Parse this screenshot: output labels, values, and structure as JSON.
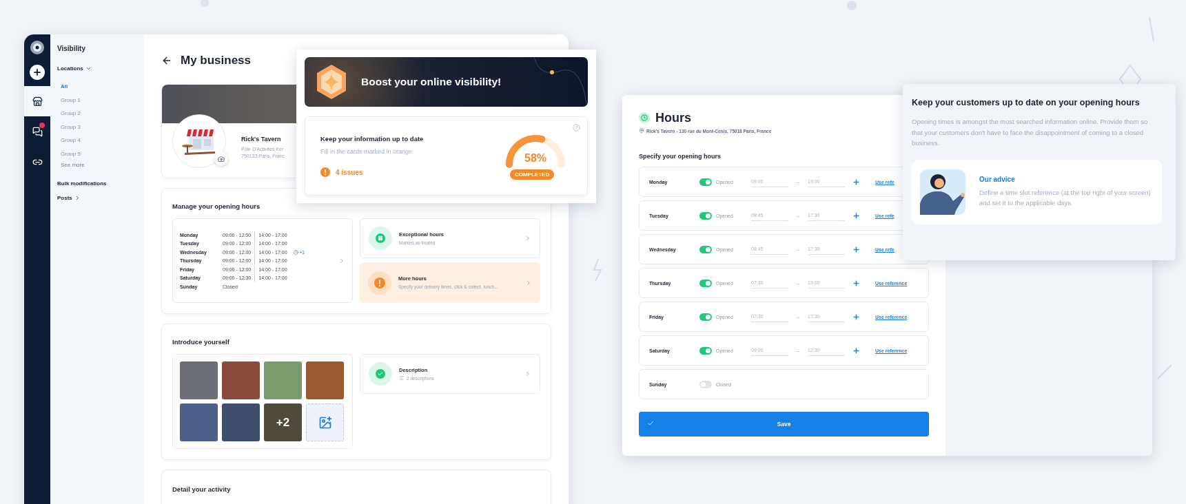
{
  "rail": {
    "items": [
      {
        "kind": "store",
        "selected": true,
        "notification": false
      },
      {
        "kind": "chat",
        "selected": false,
        "notification": true
      },
      {
        "kind": "link",
        "selected": false,
        "notification": false
      }
    ]
  },
  "sidebar": {
    "title": "Visibility",
    "sections": [
      {
        "label": "Locations",
        "expanded": true,
        "more": "See more",
        "children": [
          {
            "label": "All",
            "selected": true
          },
          {
            "label": "Group 1",
            "selected": false
          },
          {
            "label": "Group 2",
            "selected": false
          },
          {
            "label": "Group 3",
            "selected": false
          },
          {
            "label": "Group 4",
            "selected": false
          },
          {
            "label": "Group 5",
            "selected": false
          }
        ]
      },
      {
        "label": "Bulk modifications"
      },
      {
        "label": "Posts",
        "expanded": false
      }
    ]
  },
  "page": {
    "title": "My business",
    "business": {
      "name": "Rick's Tavern",
      "address_lines": [
        "Pôle D'Activités Ker",
        "750133 Paris, Franc"
      ]
    },
    "opening_hours": {
      "title": "Manage your opening hours",
      "days": [
        {
          "day": "Monday",
          "ranges": [
            "09:00 - 12:00",
            "14:00 - 17:00"
          ]
        },
        {
          "day": "Tuesday",
          "ranges": [
            "09:00 - 12:00",
            "14:00 - 17:00"
          ]
        },
        {
          "day": "Wednesday",
          "ranges": [
            "09:00 - 12:00",
            "14:00 - 17:00"
          ],
          "extra": "+1"
        },
        {
          "day": "Thursday",
          "ranges": [
            "09:00 - 12:00",
            "14:00 - 17:00"
          ]
        },
        {
          "day": "Friday",
          "ranges": [
            "09:00 - 12:00",
            "14:00 - 17:00"
          ]
        },
        {
          "day": "Saturday",
          "ranges": [
            "09:00 - 12:30",
            "14:00 - 17:00"
          ]
        },
        {
          "day": "Sunday",
          "ranges": [
            "Closed"
          ]
        }
      ],
      "cards": [
        {
          "kind": "pause",
          "title": "Exceptional hours",
          "subtitle": "Marked as treated"
        },
        {
          "kind": "warning",
          "title": "More hours",
          "subtitle": "Specify your delivery times, click & collect, lunch..."
        }
      ]
    },
    "introduce": {
      "title": "Introduce yourself",
      "photos": [
        {
          "kind": "photo"
        },
        {
          "kind": "photo"
        },
        {
          "kind": "photo"
        },
        {
          "kind": "photo"
        },
        {
          "kind": "photo"
        },
        {
          "kind": "photo"
        },
        {
          "kind": "photo",
          "more": "+2"
        },
        {
          "kind": "add"
        }
      ],
      "cards": [
        {
          "kind": "check",
          "title": "Description",
          "subtitle": "2 descriptions"
        }
      ]
    },
    "activity": {
      "title": "Detail your activity"
    }
  },
  "boost": {
    "banner": "Boost your online visibility!",
    "title": "Keep your information up to date",
    "subtitle": "Fill in the cards marked in orange",
    "issues": "4 issues",
    "gauge": {
      "level": 0.58,
      "reading": "58%",
      "label": "COMPLETED"
    }
  },
  "hours_panel": {
    "title": "Hours",
    "address": "Rick's Tavern - 130 rue du Mont-Cenis, 75018 Paris, France",
    "section": "Specify your opening hours",
    "rows": [
      {
        "day": "Monday",
        "on": true,
        "status": "Opened",
        "from": "09:00",
        "dash": "–",
        "to": "19:00",
        "link": "Use refe"
      },
      {
        "day": "Tuesday",
        "on": true,
        "status": "Opened",
        "from": "08:45",
        "dash": "–",
        "to": "17:30",
        "link": "Use refe"
      },
      {
        "day": "Wednesday",
        "on": true,
        "status": "Opened",
        "from": "08:45",
        "dash": "–",
        "to": "17:30",
        "link": "Use refe"
      },
      {
        "day": "Thursday",
        "on": true,
        "status": "Opened",
        "from": "07:30",
        "dash": "–",
        "to": "19:00",
        "link": "Use reference"
      },
      {
        "day": "Friday",
        "on": true,
        "status": "Opened",
        "from": "07:30",
        "dash": "–",
        "to": "17:30",
        "link": "Use reference"
      },
      {
        "day": "Saturday",
        "on": true,
        "status": "Opened",
        "from": "09:00",
        "dash": "–",
        "to": "12:30",
        "link": "Use reference"
      },
      {
        "day": "Sunday",
        "on": false,
        "status": "Closed"
      }
    ],
    "save": "Save"
  },
  "tip": {
    "title": "Keep your customers up to date on your opening hours",
    "body": "Opening times is amongst the most searched information online. Provide them so that your customers don't have to face the disappointment of coming to a closed business.",
    "advice_title": "Our advice",
    "advice_body": "Define a time slot reference (at the top right of your screen) and set it to the applicable days."
  }
}
